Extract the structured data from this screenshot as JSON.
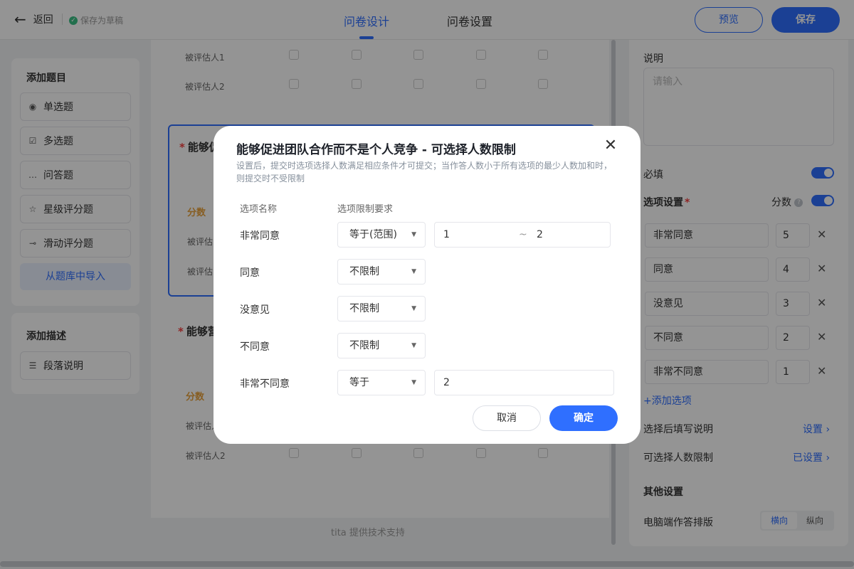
{
  "header": {
    "back_label": "返回",
    "draft_status": "保存为草稿",
    "tabs": [
      "问卷设计",
      "问卷设置"
    ],
    "preview_label": "预览",
    "save_label": "保存"
  },
  "left_panel": {
    "add_question_title": "添加题目",
    "question_types": [
      {
        "label": "单选题",
        "icon": "radio-icon"
      },
      {
        "label": "多选题",
        "icon": "checkbox-icon"
      },
      {
        "label": "问答题",
        "icon": "chat-icon"
      },
      {
        "label": "星级评分题",
        "icon": "star-icon"
      },
      {
        "label": "滑动评分题",
        "icon": "slider-icon"
      }
    ],
    "import_label": "从题库中导入",
    "add_desc_title": "添加描述",
    "paragraph_label": "段落说明"
  },
  "canvas": {
    "row1": "被评估人1",
    "row2": "被评估人2",
    "q1_title": "能够促",
    "q1_score": "分数",
    "q1_row1": "被评估",
    "q1_row2": "被评估",
    "q2_title": "能够营",
    "q2_score": "分数",
    "q2_row1": "被评估人",
    "q2_row2": "被评估人2",
    "footer": "tita 提供技术支持"
  },
  "right_panel": {
    "desc_label": "说明",
    "desc_placeholder": "请输入",
    "required_label": "必填",
    "options_label": "选项设置",
    "score_label": "分数",
    "options": [
      {
        "name": "非常同意",
        "score": "5"
      },
      {
        "name": "同意",
        "score": "4"
      },
      {
        "name": "没意见",
        "score": "3"
      },
      {
        "name": "不同意",
        "score": "2"
      },
      {
        "name": "非常不同意",
        "score": "1"
      }
    ],
    "add_option": "+添加选项",
    "after_select_label": "选择后填写说明",
    "after_select_link": "设置",
    "limit_label": "可选择人数限制",
    "limit_link": "已设置",
    "other_settings": "其他设置",
    "layout_label": "电脑端作答排版",
    "layout_options": [
      "横向",
      "纵向"
    ]
  },
  "modal": {
    "title": "能够促进团队合作而不是个人竞争 - 可选择人数限制",
    "description": "设置后，提交时选项选择人数满足相应条件才可提交；当作答人数小于所有选项的最少人数加和时，则提交时不受限制",
    "col_option": "选项名称",
    "col_requirement": "选项限制要求",
    "rows": [
      {
        "name": "非常同意",
        "mode": "等于(范围)",
        "min": "1",
        "sep": "~",
        "max": "2"
      },
      {
        "name": "同意",
        "mode": "不限制"
      },
      {
        "name": "没意见",
        "mode": "不限制"
      },
      {
        "name": "不同意",
        "mode": "不限制"
      },
      {
        "name": "非常不同意",
        "mode": "等于",
        "value": "2"
      }
    ],
    "cancel_label": "取消",
    "ok_label": "确定"
  },
  "colors": {
    "accent": "#2f6fff",
    "score": "#e8a33d",
    "required": "#f53f3f"
  }
}
